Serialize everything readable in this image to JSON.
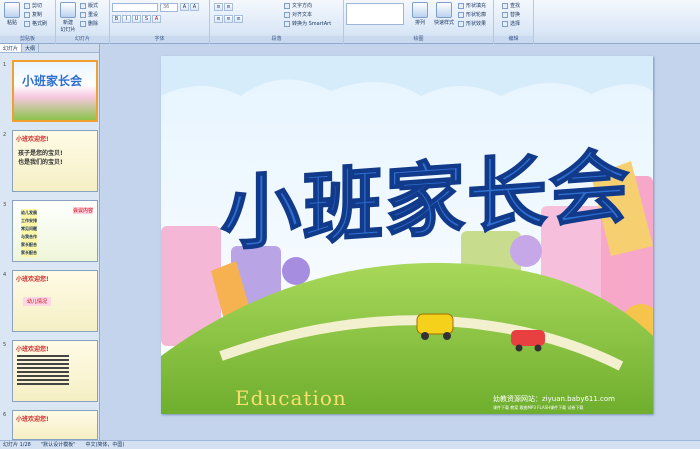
{
  "ribbon": {
    "groups": [
      "剪贴板",
      "幻灯片",
      "字体",
      "段落",
      "绘图",
      "编辑"
    ],
    "clipboard": {
      "paste": "粘贴",
      "cut": "剪切",
      "copy": "复制",
      "painter": "格式刷"
    },
    "slides": {
      "new": "新建",
      "new2": "幻灯片",
      "layout": "版式",
      "reset": "重设",
      "delete": "删除"
    },
    "font": {
      "size": "36"
    },
    "paragraph": {
      "textdir": "文字方向",
      "align": "对齐文本",
      "smartart": "转换为 SmartArt"
    },
    "drawing": {
      "arrange": "排列",
      "quick": "快速样式",
      "fill": "形状填充",
      "outline": "形状轮廓",
      "effect": "形状效果"
    },
    "editing": {
      "find": "查找",
      "replace": "替换",
      "select": "选择"
    }
  },
  "left": {
    "tab_slides": "幻灯片",
    "tab_outline": "大纲",
    "thumbs": [
      {
        "num": "1",
        "title": "小班家长会"
      },
      {
        "num": "2",
        "title": "小班欢迎您!",
        "l1": "孩子是您的宝贝!",
        "l2": "也是我们的宝贝!"
      },
      {
        "num": "3",
        "items": [
          "幼儿发展",
          "工作安排",
          "常见问题",
          "与我合作",
          "家长配合",
          "家长配合"
        ],
        "tag": "会议内容"
      },
      {
        "num": "4",
        "title": "小班欢迎您!",
        "l1": "幼儿情况"
      },
      {
        "num": "5",
        "title": "小班欢迎您!"
      },
      {
        "num": "6",
        "title": "小班欢迎您!"
      }
    ]
  },
  "slide": {
    "title": "小班家长会",
    "edu": "Education",
    "site": "幼教资源网站：ziyuan.baby611.com",
    "site2": "课件下载  教案  歌曲MP3  FLASH课件下载  试卷下载"
  },
  "status": {
    "page": "幻灯片 1/28",
    "theme": "\"默认设计模板\"",
    "lang": "中文(简体，中国)"
  },
  "colors": {
    "title": "#2f6fd0",
    "grass": "#8bc34a"
  }
}
